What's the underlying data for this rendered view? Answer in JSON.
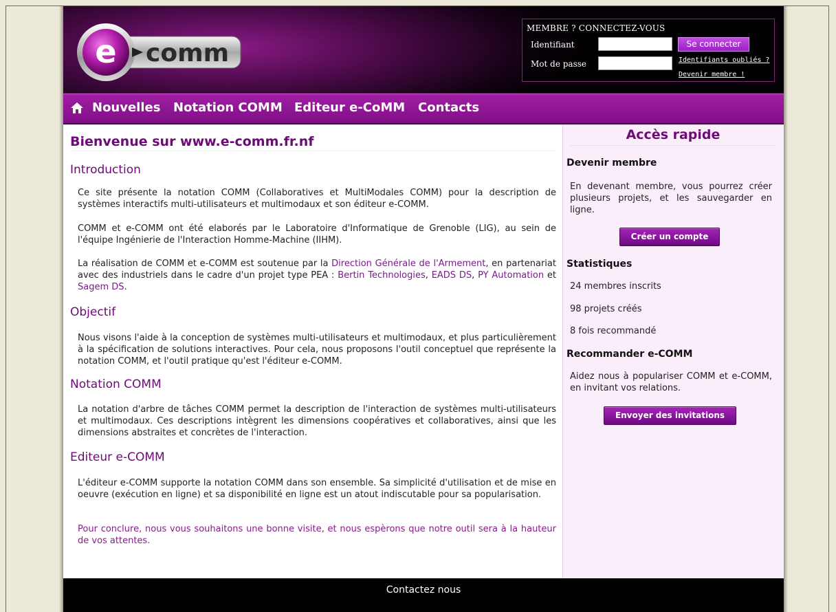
{
  "logo": {
    "text": "comm",
    "letter": "e"
  },
  "login": {
    "title": "MEMBRE ? CONNECTEZ-VOUS",
    "identifiant_label": "Identifiant",
    "password_label": "Mot de passe",
    "identifiant_value": "",
    "password_value": "",
    "submit_label": "Se connecter",
    "forgot_link": "Identifiants oubliés ?",
    "register_link": "Devenir membre !"
  },
  "nav": {
    "home_icon": "home-icon",
    "items": [
      "Nouvelles",
      "Notation COMM",
      "Editeur e-CoMM",
      "Contacts"
    ]
  },
  "main": {
    "title": "Bienvenue sur www.e-comm.fr.nf",
    "intro_heading": "Introduction",
    "intro_p1": "Ce site présente la notation COMM (Collaboratives et MultiModales COMM) pour la description de systèmes interactifs  multi-utilisateurs et multimodaux et son éditeur e-COMM.",
    "intro_p2": "COMM et e-COMM ont été elaborés par le Laboratoire d'Informatique de Grenoble (LIG), au sein de l'équipe Ingénierie de l'Interaction Homme-Machine (IIHM).",
    "intro_p3_a": "La réalisation de COMM et e-COMM est soutenue par la ",
    "intro_p3_link1": "Direction Générale de l'Armement",
    "intro_p3_b": ", en partenariat avec des industriels dans le cadre d'un projet type PEA : ",
    "intro_p3_link2": "Bertin Technologies",
    "intro_p3_c": ", ",
    "intro_p3_link3": "EADS DS",
    "intro_p3_d": ", ",
    "intro_p3_link4": "PY Automation",
    "intro_p3_e": " et ",
    "intro_p3_link5": "Sagem DS",
    "intro_p3_f": ".",
    "objectif_heading": "Objectif",
    "objectif_p": "Nous visons l'aide à la conception de systèmes multi-utilisateurs et multimodaux, et plus particulièrement à la spécification de solutions interactives. Pour cela, nous proposons l'outil conceptuel que représente la notation COMM, et l'outil pratique qu'est l'éditeur e-COMM.",
    "notation_heading": "Notation COMM",
    "notation_p": "La notation d'arbre de tâches COMM permet la description de l'interaction de systèmes multi-utilisateurs et multimodaux. Ces descriptions intègrent les dimensions coopératives et collaboratives, ainsi que les dimensions abstraites et concrètes de l'interaction.",
    "editeur_heading": "Editeur e-COMM",
    "editeur_p": "L'éditeur e-COMM supporte la notation COMM dans son ensemble. Sa simplicité d'utilisation et de mise en oeuvre (exécution en ligne) et sa disponibilité en ligne est un atout indiscutable pour sa popularisation.",
    "closing_p": "Pour conclure, nous vous souhaitons une bonne visite, et nous espèrons que notre outil sera à la hauteur de vos attentes."
  },
  "sidebar": {
    "title": "Accès rapide",
    "member_heading": "Devenir membre",
    "member_p": "En devenant membre, vous pourrez créer plusieurs projets, et les sauvegarder en ligne.",
    "create_button": "Créer un compte",
    "stats_heading": "Statistiques",
    "stat_members": "24 membres inscrits",
    "stat_projects": "98 projets créés",
    "stat_recommended": "8 fois recommandé",
    "recommend_heading": "Recommander e-COMM",
    "recommend_p": "Aidez nous à populariser COMM et e-COMM, en invitant vos relations.",
    "invite_button": "Envoyer des invitations"
  },
  "footer": {
    "contact_link": "Contactez nous"
  },
  "colors": {
    "accent": "#7a1a8a",
    "nav": "#95199b",
    "sidebar_bg": "#fbeefb",
    "footer": "#000000"
  }
}
